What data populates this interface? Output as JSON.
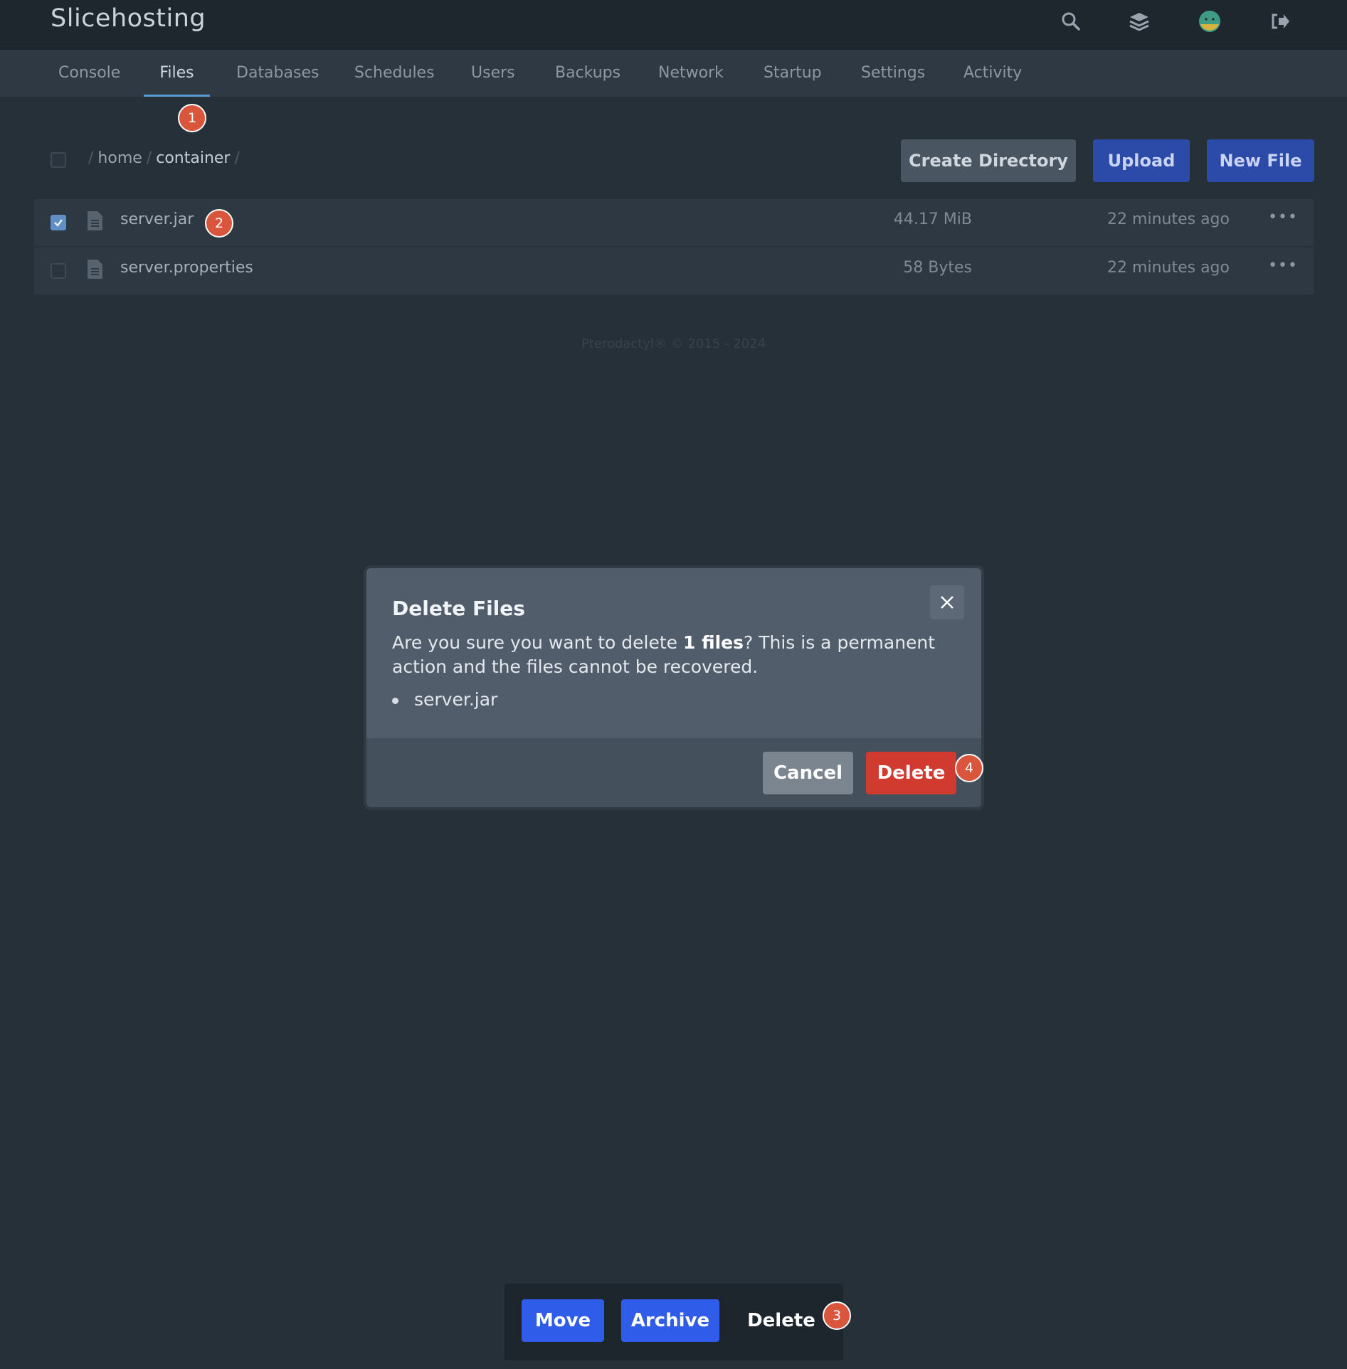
{
  "app": {
    "title": "Slicehosting"
  },
  "header_icons": [
    "search-icon",
    "layers-icon",
    "avatar",
    "logout-icon"
  ],
  "nav": {
    "tabs": [
      {
        "label": "Console"
      },
      {
        "label": "Files",
        "active": true
      },
      {
        "label": "Databases"
      },
      {
        "label": "Schedules"
      },
      {
        "label": "Users"
      },
      {
        "label": "Backups"
      },
      {
        "label": "Network"
      },
      {
        "label": "Startup"
      },
      {
        "label": "Settings"
      },
      {
        "label": "Activity"
      }
    ]
  },
  "markers": [
    "1",
    "2",
    "3",
    "4"
  ],
  "breadcrumb": {
    "separator": "/",
    "parts": [
      "home",
      "container"
    ]
  },
  "toolbar": {
    "create_directory": "Create Directory",
    "upload": "Upload",
    "new_file": "New File"
  },
  "files": [
    {
      "name": "server.jar",
      "size": "44.17 MiB",
      "modified": "22 minutes ago",
      "selected": true
    },
    {
      "name": "server.properties",
      "size": "58 Bytes",
      "modified": "22 minutes ago",
      "selected": false
    }
  ],
  "footer": {
    "text": "Pterodactyl® © 2015 - 2024"
  },
  "modal": {
    "title": "Delete Files",
    "message_pre": "Are you sure you want to delete ",
    "message_bold": "1 files",
    "message_post": "? This is a permanent action and the files cannot be recovered.",
    "items": [
      "server.jar"
    ],
    "cancel_label": "Cancel",
    "delete_label": "Delete"
  },
  "action_bar": {
    "move": "Move",
    "archive": "Archive",
    "delete": "Delete"
  },
  "colors": {
    "background": "#263039",
    "topbar": "#1e262e",
    "navbar": "#2e3944",
    "primary": "#2f5ce9",
    "danger": "#d13a2f",
    "marker": "#d9553b"
  }
}
